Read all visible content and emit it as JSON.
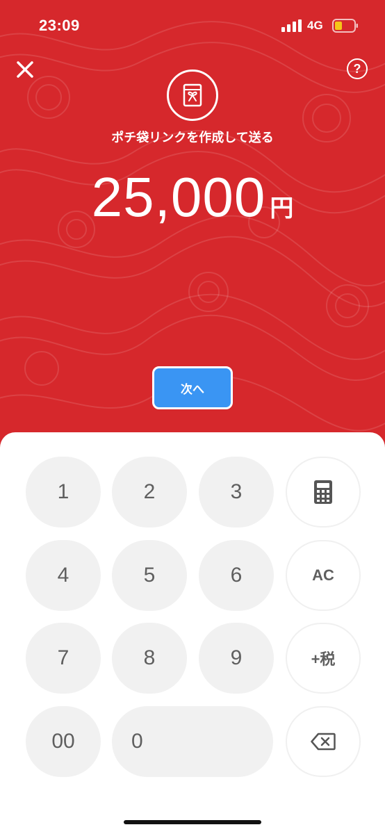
{
  "status_bar": {
    "time": "23:09",
    "network": "4G"
  },
  "header": {
    "help_label": "?"
  },
  "main": {
    "subtitle": "ポチ袋リンクを作成して送る",
    "amount": "25,000",
    "currency": "円",
    "next_button": "次へ"
  },
  "keypad": {
    "k1": "1",
    "k2": "2",
    "k3": "3",
    "k4": "4",
    "k5": "5",
    "k6": "6",
    "k7": "7",
    "k8": "8",
    "k9": "9",
    "k00": "00",
    "k0": "0",
    "ac": "AC",
    "tax": "+税"
  },
  "colors": {
    "background_red": "#d6282c",
    "accent_blue": "#3a95f3",
    "key_gray": "#f1f1f1",
    "battery_yellow": "#f5c518"
  },
  "icons": [
    "close-icon",
    "help-icon",
    "envelope-gift-icon",
    "calculator-icon",
    "backspace-icon",
    "signal-icon",
    "battery-icon"
  ]
}
